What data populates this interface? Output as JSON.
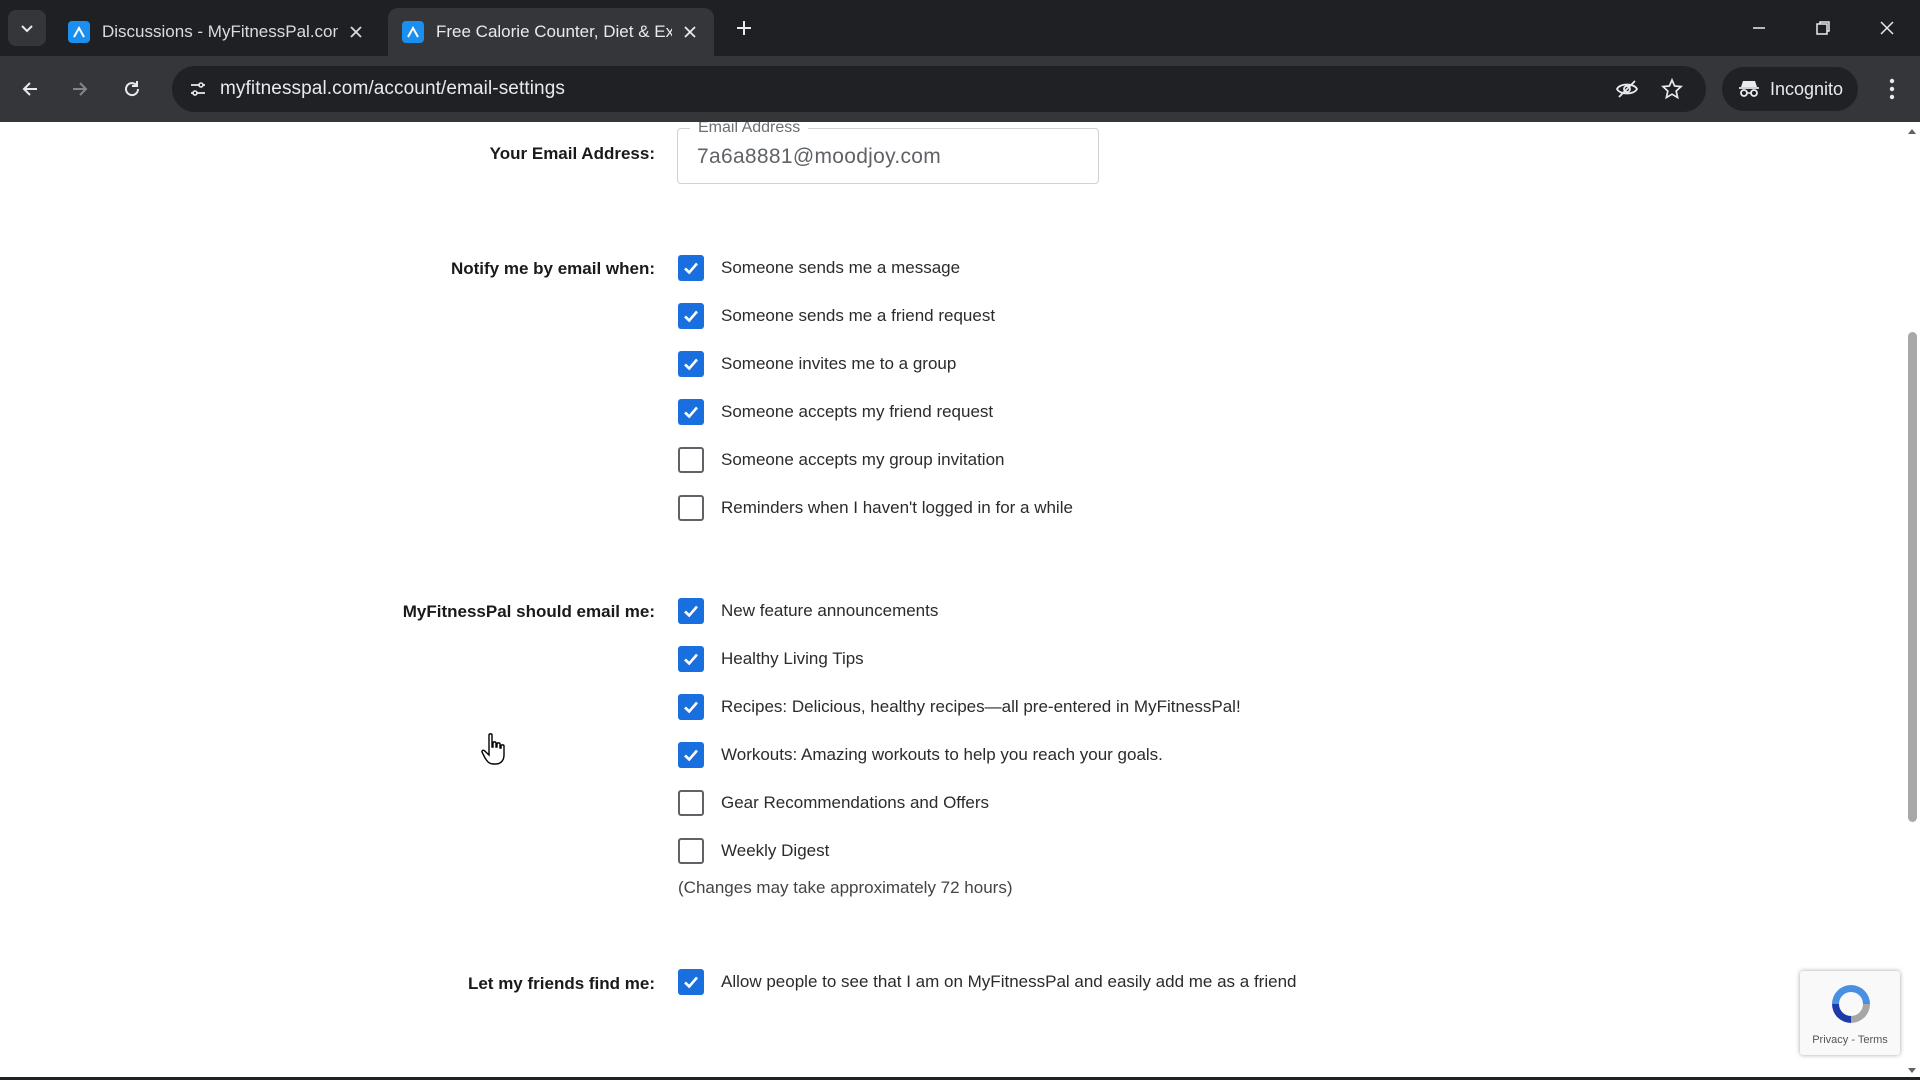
{
  "browser": {
    "tabs": [
      {
        "title": "Discussions - MyFitnessPal.com",
        "active": false
      },
      {
        "title": "Free Calorie Counter, Diet & Exercise",
        "active": true
      }
    ],
    "url": "myfitnesspal.com/account/email-settings",
    "incognito_label": "Incognito"
  },
  "email_section": {
    "label": "Your Email Address:",
    "field_legend": "Email Address",
    "value": "7a6a8881@moodjoy.com"
  },
  "notify_section": {
    "label": "Notify me by email when:",
    "options": [
      {
        "label": "Someone sends me a message",
        "checked": true
      },
      {
        "label": "Someone sends me a friend request",
        "checked": true
      },
      {
        "label": "Someone invites me to a group",
        "checked": true
      },
      {
        "label": "Someone accepts my friend request",
        "checked": true
      },
      {
        "label": "Someone accepts my group invitation",
        "checked": false
      },
      {
        "label": "Reminders when I haven't logged in for a while",
        "checked": false
      }
    ]
  },
  "mfp_section": {
    "label": "MyFitnessPal should email me:",
    "options": [
      {
        "label": "New feature announcements",
        "checked": true
      },
      {
        "label": "Healthy Living Tips",
        "checked": true
      },
      {
        "label": "Recipes: Delicious, healthy recipes—all pre-entered in MyFitnessPal!",
        "checked": true
      },
      {
        "label": "Workouts: Amazing workouts to help you reach your goals.",
        "checked": true
      },
      {
        "label": "Gear Recommendations and Offers",
        "checked": false
      },
      {
        "label": "Weekly Digest",
        "checked": false
      }
    ],
    "note": "(Changes may take approximately 72 hours)"
  },
  "friends_section": {
    "label": "Let my friends find me:",
    "options": [
      {
        "label": "Allow people to see that I am on MyFitnessPal and easily add me as a friend",
        "checked": true
      }
    ]
  },
  "recaptcha": {
    "links": "Privacy - Terms"
  },
  "colors": {
    "checkbox_checked": "#1a6fdf",
    "chrome_bg": "#1f2023",
    "toolbar_bg": "#35363a"
  }
}
